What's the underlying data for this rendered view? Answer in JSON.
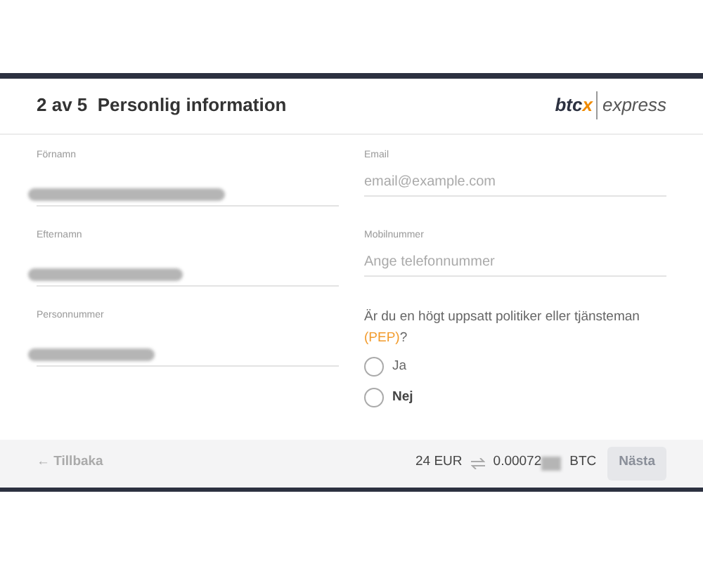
{
  "header": {
    "title": "2 av 5  Personlig information",
    "logo": {
      "brand_dark": "btc",
      "brand_accent": "x",
      "suffix": "express"
    }
  },
  "left_fields": [
    {
      "label": "Förnamn",
      "redacted": true
    },
    {
      "label": "Efternamn",
      "redacted": true
    },
    {
      "label": "Personnummer",
      "redacted": true
    }
  ],
  "right_fields": [
    {
      "label": "Email",
      "placeholder": "email@example.com"
    },
    {
      "label": "Mobilnummer",
      "placeholder": "Ange telefonnummer"
    }
  ],
  "pep_question": {
    "text": "Är du en högt uppsatt politiker eller tjänsteman",
    "highlight": "(PEP)",
    "suffix": "?"
  },
  "pep_options": [
    {
      "label": "Ja",
      "selected": false,
      "emphasized": false
    },
    {
      "label": "Nej",
      "selected": false,
      "emphasized": true
    }
  ],
  "footer": {
    "back": "← Tillbaka",
    "amount_eur": "24 EUR",
    "amount_btc": "0.00072",
    "btc_redacted": true,
    "btc_unit": "BTC",
    "next": {
      "label": "Nästa",
      "disabled": true
    }
  }
}
